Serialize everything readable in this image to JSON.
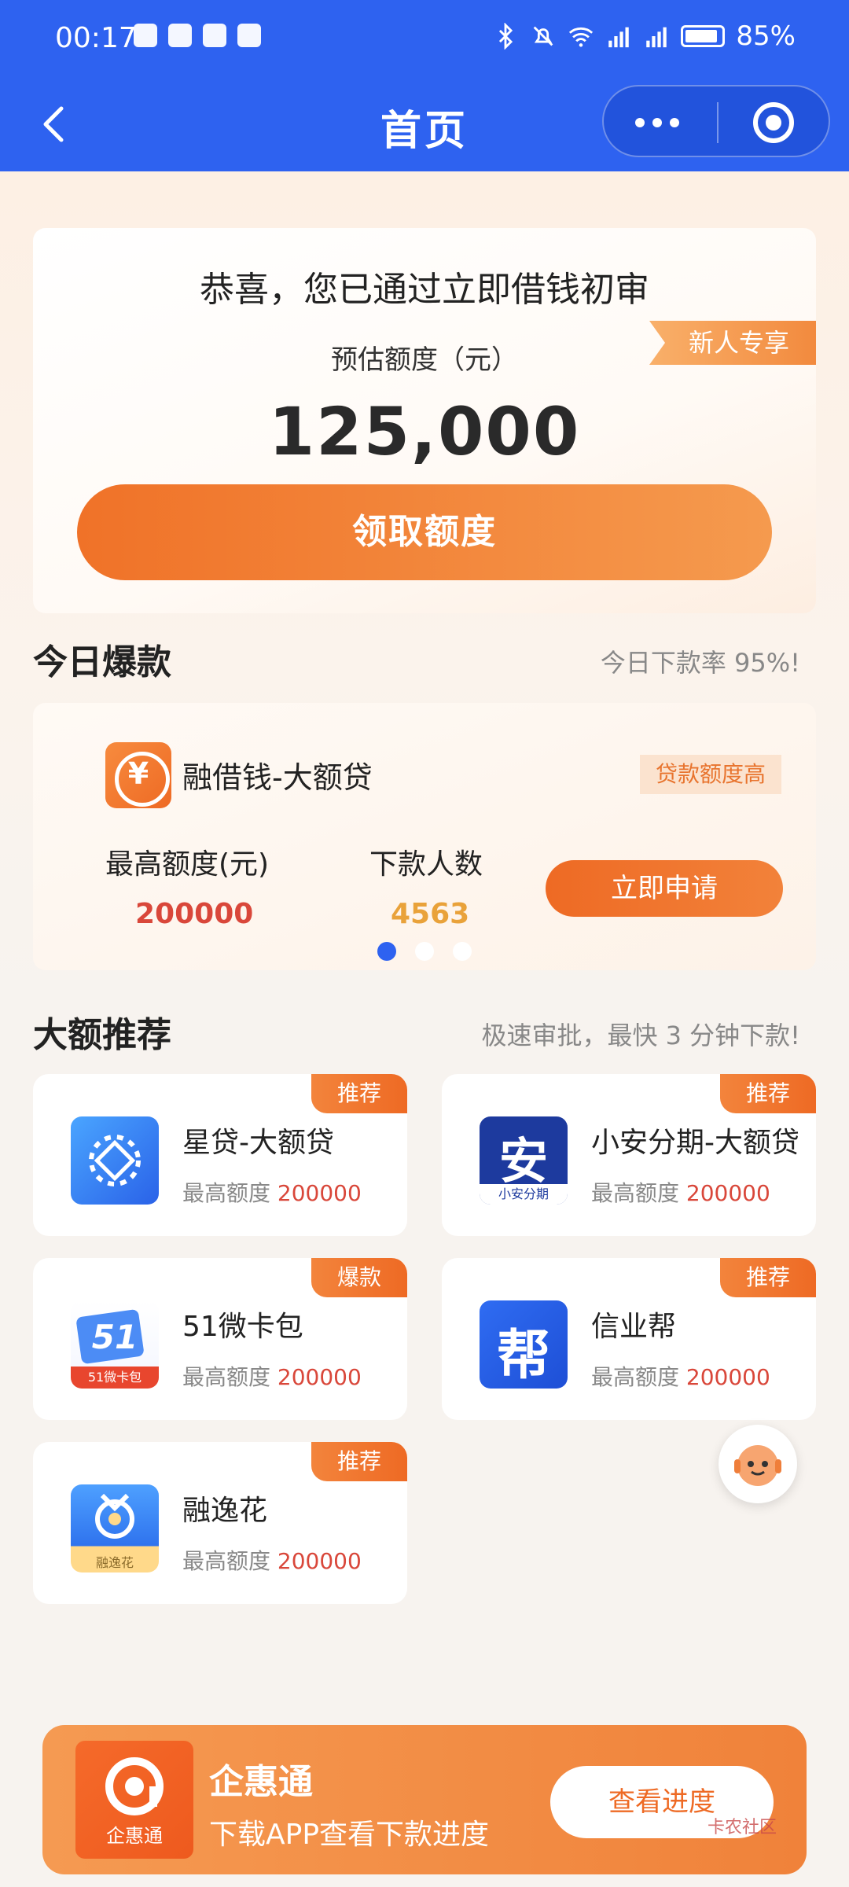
{
  "status_bar": {
    "time": "00:17",
    "battery": "85%"
  },
  "nav": {
    "title": "首页"
  },
  "hero": {
    "title": "恭喜，您已通过立即借钱初审",
    "subtitle": "预估额度（元）",
    "badge": "新人专享",
    "amount": "125,000",
    "button": "领取额度"
  },
  "today_hot": {
    "title": "今日爆款",
    "note": "今日下款率 95%!",
    "product": {
      "logo_char": "¥",
      "name": "融借钱-大额贷",
      "tag": "贷款额度高",
      "max_label": "最高额度(元)",
      "max_value": "200000",
      "count_label": "下款人数",
      "count_value": "4563",
      "button": "立即申请"
    }
  },
  "large_recommend": {
    "title": "大额推荐",
    "note": "极速审批，最快 3 分钟下款!",
    "limit_label": "最高额度",
    "items": [
      {
        "tag": "推荐",
        "name": "星贷-大额贷",
        "limit": "200000"
      },
      {
        "tag": "推荐",
        "name": "小安分期-大额贷",
        "limit": "200000",
        "logo_char": "安",
        "logo_text": "小安分期"
      },
      {
        "tag": "爆款",
        "name": "51微卡包",
        "limit": "200000",
        "logo_char": "51",
        "logo_text": "51微卡包"
      },
      {
        "tag": "推荐",
        "name": "信业帮",
        "limit": "200000",
        "logo_char": "帮"
      },
      {
        "tag": "推荐",
        "name": "融逸花",
        "limit": "200000",
        "logo_text": "融逸花"
      }
    ]
  },
  "banner": {
    "logo_text": "企惠通",
    "title": "企惠通",
    "subtitle": "下载APP查看下款进度",
    "button": "查看进度",
    "watermark": "卡农社区"
  }
}
